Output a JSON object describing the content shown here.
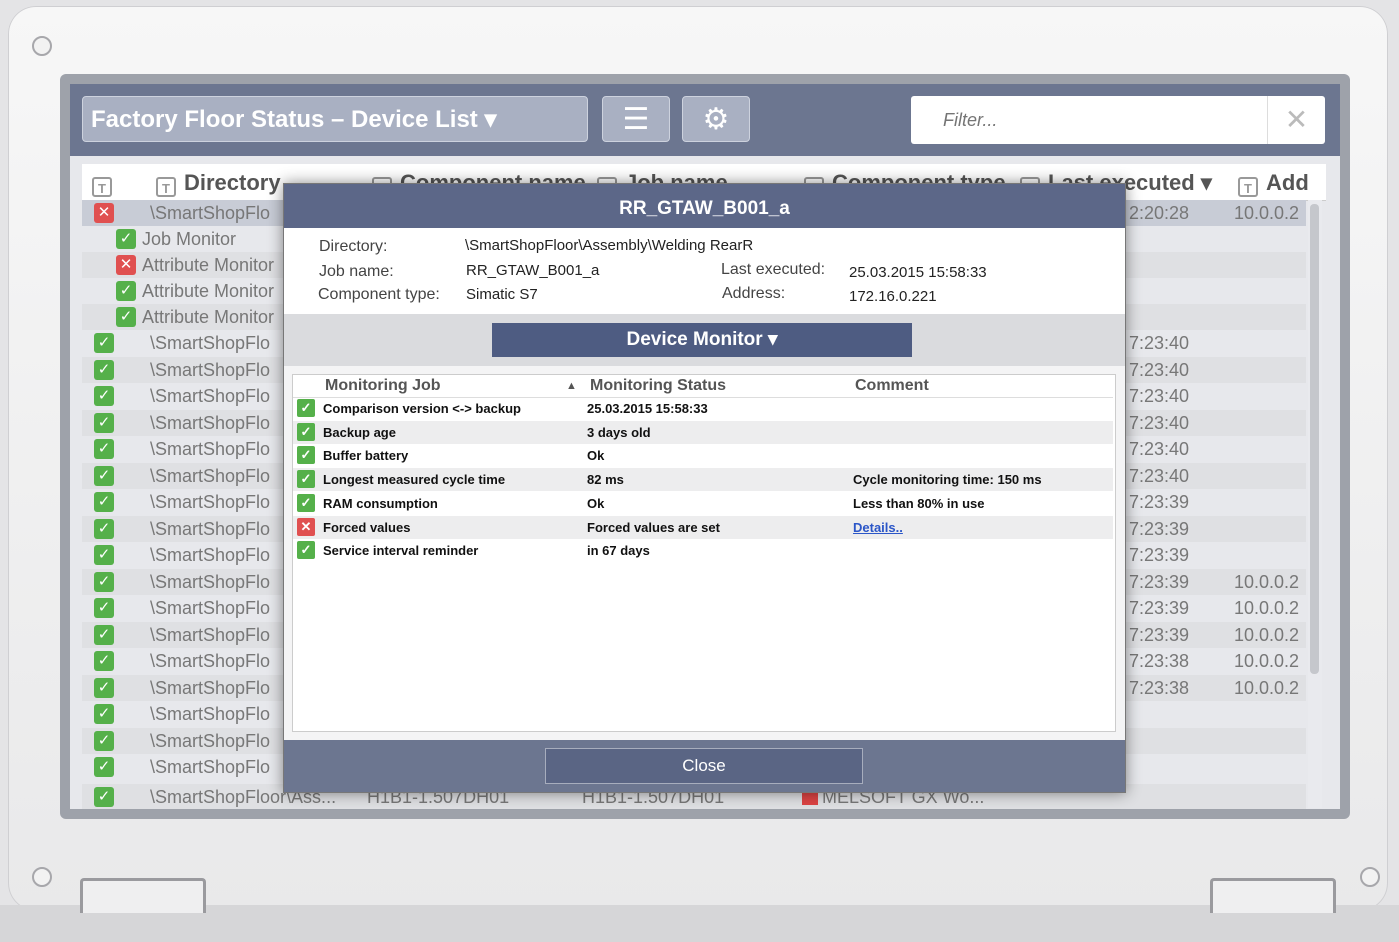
{
  "header": {
    "title": "Factory Floor Status – Device List ▾",
    "filter_placeholder": "Filter...",
    "clear_symbol": "✕"
  },
  "columns": {
    "directory": "Directory",
    "component_name": "Component name",
    "job_name": "Job name",
    "component_type": "Component type",
    "last_executed": "Last executed ▾",
    "address": "Add"
  },
  "list": {
    "selected_dir": "\\SmartShopFlo",
    "selected_time": "2:20:28",
    "selected_addr": "10.0.0.2",
    "child_rows": [
      {
        "label": "Job Monitor",
        "status": "ok"
      },
      {
        "label": "Attribute Monitor",
        "status": "error"
      },
      {
        "label": "Attribute Monitor",
        "status": "ok"
      },
      {
        "label": "Attribute Monitor",
        "status": "ok"
      }
    ],
    "device_rows": [
      {
        "dir": "\\SmartShopFlo",
        "time": "7:23:40",
        "addr": ""
      },
      {
        "dir": "\\SmartShopFlo",
        "time": "7:23:40",
        "addr": ""
      },
      {
        "dir": "\\SmartShopFlo",
        "time": "7:23:40",
        "addr": ""
      },
      {
        "dir": "\\SmartShopFlo",
        "time": "7:23:40",
        "addr": ""
      },
      {
        "dir": "\\SmartShopFlo",
        "time": "7:23:40",
        "addr": ""
      },
      {
        "dir": "\\SmartShopFlo",
        "time": "7:23:40",
        "addr": ""
      },
      {
        "dir": "\\SmartShopFlo",
        "time": "7:23:39",
        "addr": ""
      },
      {
        "dir": "\\SmartShopFlo",
        "time": "7:23:39",
        "addr": ""
      },
      {
        "dir": "\\SmartShopFlo",
        "time": "7:23:39",
        "addr": ""
      },
      {
        "dir": "\\SmartShopFlo",
        "time": "7:23:39",
        "addr": "10.0.0.2"
      },
      {
        "dir": "\\SmartShopFlo",
        "time": "7:23:39",
        "addr": "10.0.0.2"
      },
      {
        "dir": "\\SmartShopFlo",
        "time": "7:23:39",
        "addr": "10.0.0.2"
      },
      {
        "dir": "\\SmartShopFlo",
        "time": "7:23:38",
        "addr": "10.0.0.2"
      },
      {
        "dir": "\\SmartShopFlo",
        "time": "7:23:38",
        "addr": "10.0.0.2"
      },
      {
        "dir": "\\SmartShopFlo",
        "time": "",
        "addr": ""
      },
      {
        "dir": "\\SmartShopFlo",
        "time": "",
        "addr": ""
      },
      {
        "dir": "\\SmartShopFlo",
        "time": "",
        "addr": ""
      }
    ],
    "last_row": {
      "dir": "\\SmartShopFloor\\Ass...",
      "component": "H1B1-1.507DH01",
      "job": "H1B1-1.507DH01",
      "type": "MELSOFT GX Wo..."
    }
  },
  "modal": {
    "title": "RR_GTAW_B001_a",
    "directory_label": "Directory:",
    "directory_value": "\\SmartShopFloor\\Assembly\\Welding RearR",
    "job_label": "Job name:",
    "job_value": "RR_GTAW_B001_a",
    "type_label": "Component type:",
    "type_value": "Simatic S7",
    "executed_label": "Last executed:",
    "executed_value": "25.03.2015 15:58:33",
    "address_label": "Address:",
    "address_value": "172.16.0.221",
    "monitor_button": "Device Monitor ▾",
    "col_job": "Monitoring Job",
    "col_status": "Monitoring Status",
    "col_comment": "Comment",
    "sort_symbol": "▲",
    "rows": [
      {
        "job": "Comparison  version <-> backup",
        "status": "25.03.2015 15:58:33",
        "comment": "",
        "state": "ok"
      },
      {
        "job": "Backup age",
        "status": "3 days old",
        "comment": "",
        "state": "ok"
      },
      {
        "job": "Buffer battery",
        "status": "Ok",
        "comment": "",
        "state": "ok"
      },
      {
        "job": "Longest measured cycle time",
        "status": "82 ms",
        "comment": "Cycle monitoring time: 150 ms",
        "state": "ok"
      },
      {
        "job": "RAM consumption",
        "status": "Ok",
        "comment": "Less than 80% in use",
        "state": "ok"
      },
      {
        "job": "Forced values",
        "status": "Forced values are set",
        "comment": "Details..",
        "state": "error"
      },
      {
        "job": "Service interval reminder",
        "status": "in 67 days",
        "comment": "",
        "state": "ok"
      }
    ],
    "close_button": "Close"
  }
}
